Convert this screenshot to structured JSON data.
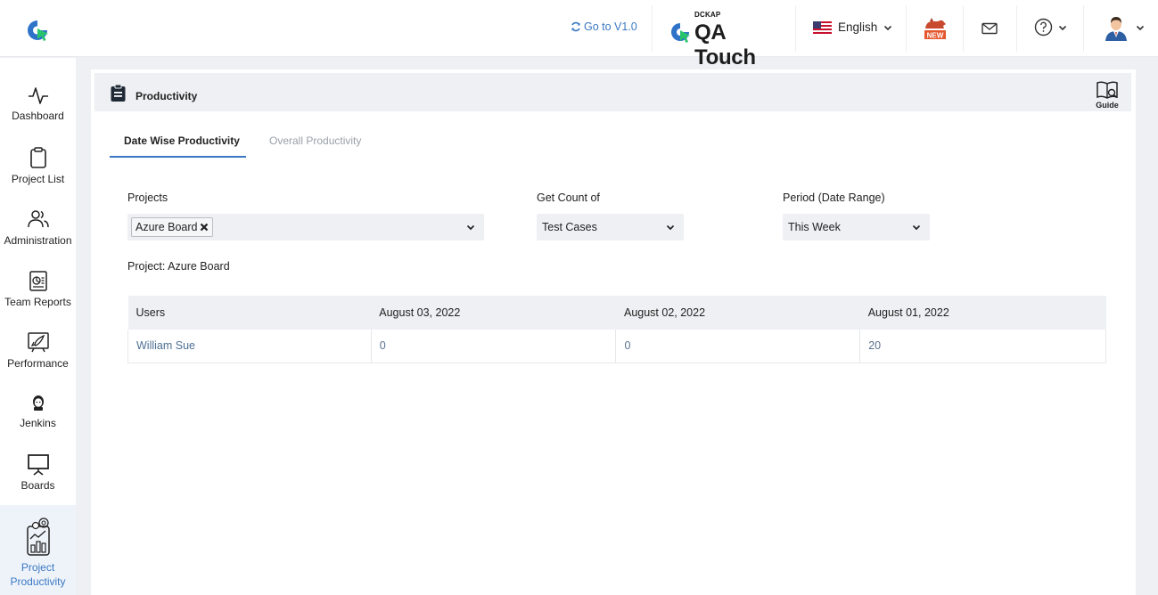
{
  "header": {
    "goto_label": "Go to V1.0",
    "brand_top": "DCKAP",
    "brand_name": "QA Touch",
    "language": "English",
    "new_badge": "NEW"
  },
  "sidebar": {
    "items": [
      {
        "label": "Dashboard",
        "icon": "activity-icon"
      },
      {
        "label": "Project List",
        "icon": "clipboard-icon"
      },
      {
        "label": "Administration",
        "icon": "users-icon"
      },
      {
        "label": "Team Reports",
        "icon": "report-icon"
      },
      {
        "label": "Performance",
        "icon": "rocket-chart-icon"
      },
      {
        "label": "Jenkins",
        "icon": "jenkins-icon"
      },
      {
        "label": "Boards",
        "icon": "board-icon"
      },
      {
        "label_line1": "Project",
        "label_line2": "Productivity",
        "icon": "productivity-icon"
      }
    ]
  },
  "page": {
    "title": "Productivity",
    "guide_label": "Guide"
  },
  "tabs": [
    {
      "label": "Date Wise Productivity",
      "active": true
    },
    {
      "label": "Overall Productivity",
      "active": false
    }
  ],
  "filters": {
    "projects_label": "Projects",
    "project_chip": "Azure Board",
    "count_label": "Get Count of",
    "count_value": "Test Cases",
    "period_label": "Period (Date Range)",
    "period_value": "This Week"
  },
  "project_line": "Project: Azure Board",
  "table": {
    "headers": [
      "Users",
      "August 03, 2022",
      "August 02, 2022",
      "August 01, 2022"
    ],
    "rows": [
      [
        "William Sue",
        "0",
        "0",
        "20"
      ]
    ]
  },
  "colors": {
    "accent": "#3b78c3",
    "brand_green": "#2ecc71",
    "panel_bg": "#eef0f3"
  }
}
